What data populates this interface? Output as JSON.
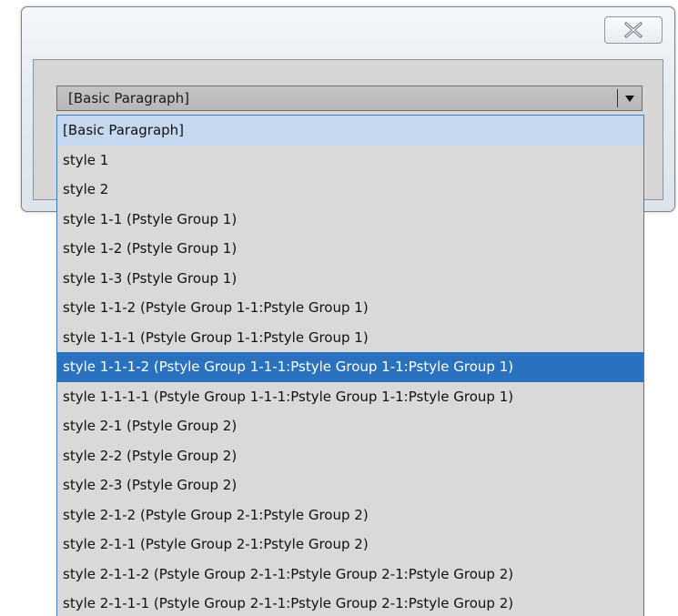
{
  "dialog": {
    "close_icon": "close-x-icon"
  },
  "combo": {
    "value": "[Basic Paragraph]",
    "arrow_icon": "chevron-down-icon"
  },
  "dropdown": {
    "selected_index": 0,
    "highlighted_index": 8,
    "items": [
      "[Basic Paragraph]",
      "style 1",
      "style 2",
      "style 1-1 (Pstyle Group 1)",
      "style 1-2 (Pstyle Group 1)",
      "style 1-3 (Pstyle Group 1)",
      "style 1-1-2 (Pstyle Group 1-1:Pstyle Group 1)",
      "style 1-1-1 (Pstyle Group 1-1:Pstyle Group 1)",
      "style 1-1-1-2 (Pstyle Group 1-1-1:Pstyle Group 1-1:Pstyle Group 1)",
      "style 1-1-1-1 (Pstyle Group 1-1-1:Pstyle Group 1-1:Pstyle Group 1)",
      "style 2-1 (Pstyle Group 2)",
      "style 2-2 (Pstyle Group 2)",
      "style 2-3 (Pstyle Group 2)",
      "style 2-1-2 (Pstyle Group 2-1:Pstyle Group 2)",
      "style 2-1-1 (Pstyle Group 2-1:Pstyle Group 2)",
      "style 2-1-1-2 (Pstyle Group 2-1-1:Pstyle Group 2-1:Pstyle Group 2)",
      "style 2-1-1-1 (Pstyle Group 2-1-1:Pstyle Group 2-1:Pstyle Group 2)"
    ]
  },
  "colors": {
    "highlight": "#2a72c0",
    "current": "#c5d8ef",
    "list_background": "#d9d9d9",
    "list_border": "#3a7ec6"
  }
}
